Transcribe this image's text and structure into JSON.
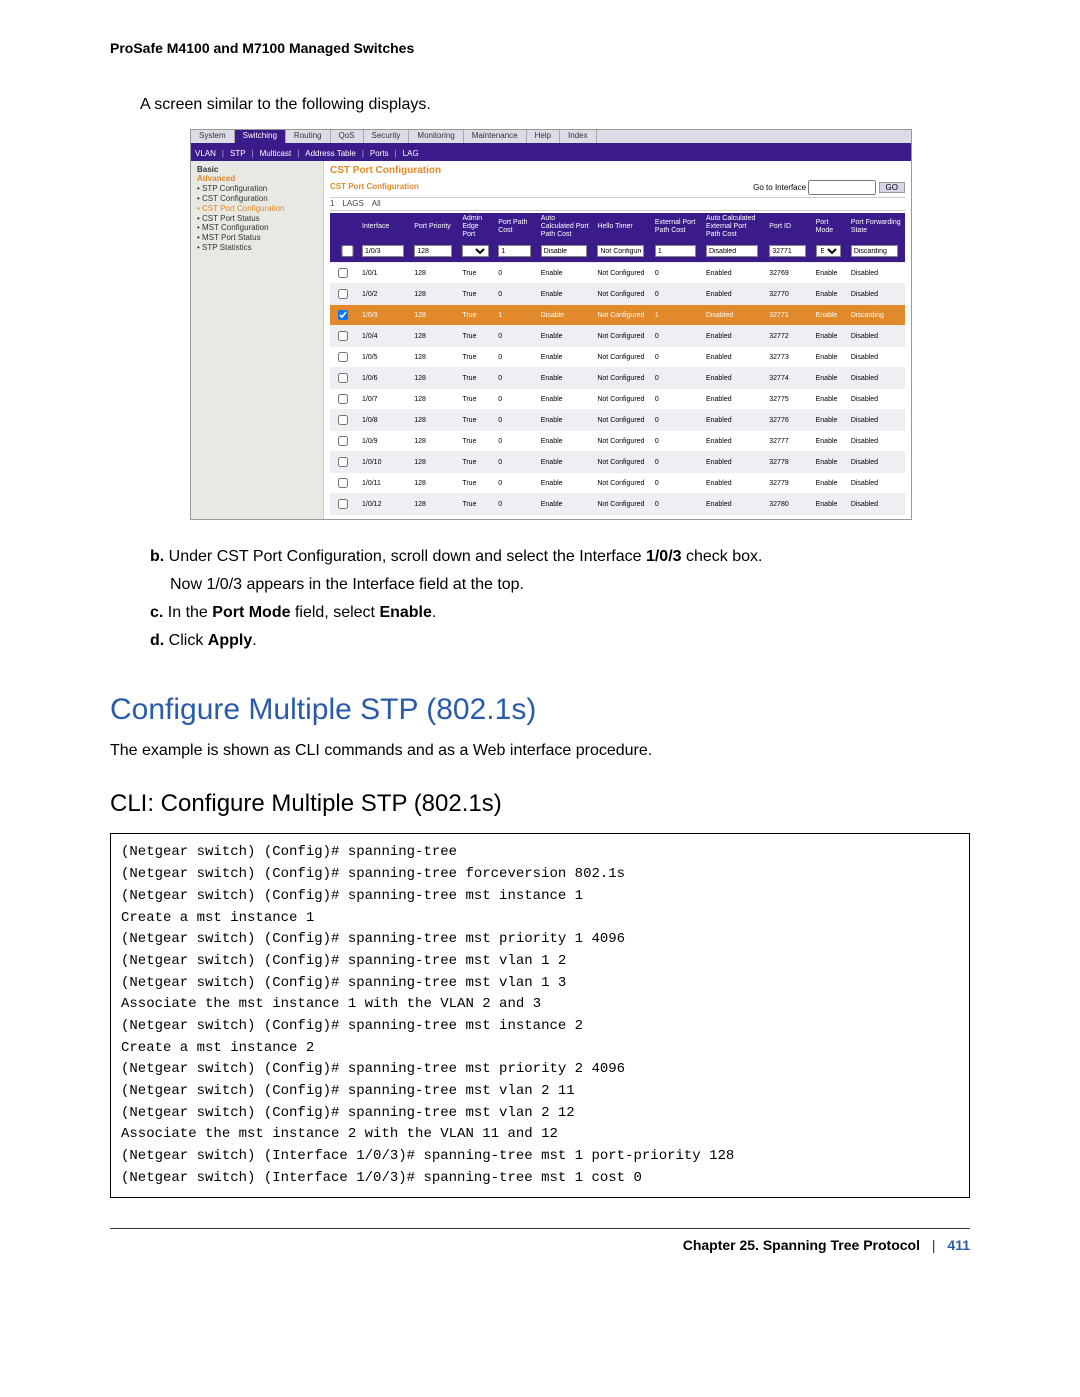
{
  "doc_header": "ProSafe M4100 and M7100 Managed Switches",
  "intro": "A screen similar to the following displays.",
  "nav": {
    "tabs1": [
      "System",
      "Switching",
      "Routing",
      "QoS",
      "Security",
      "Monitoring",
      "Maintenance",
      "Help",
      "Index"
    ],
    "tabs1_active": 1,
    "tabs2": [
      "VLAN",
      "STP",
      "Multicast",
      "Address Table",
      "Ports",
      "LAG"
    ]
  },
  "sidebar": {
    "basic": "Basic",
    "adv": "Advanced",
    "items": [
      "STP Configuration",
      "CST Configuration",
      "CST Port Configuration",
      "CST Port Status",
      "MST Configuration",
      "MST Port Status",
      "STP Statistics"
    ],
    "selected": 2
  },
  "panel": {
    "title": "CST Port Configuration",
    "subtitle": "CST Port Configuration",
    "filters": [
      "1",
      "LAGS",
      "All"
    ],
    "goto_label": "Go to Interface",
    "go_btn": "GO"
  },
  "grid": {
    "columns": [
      "",
      "Interface",
      "Port Priority",
      "Admin Edge Port",
      "Port Path Cost",
      "Auto Calculated Port Path Cost",
      "Hello Timer",
      "External Port Path Cost",
      "Auto Calculated External Port Path Cost",
      "Port ID",
      "Port Mode",
      "Port Forwarding State"
    ],
    "input_row": {
      "interface": "1/0/3",
      "priority": "128",
      "edge": "",
      "cost": "1",
      "auto": "Disable",
      "hello": "Not Configured",
      "ext": "1",
      "autoext": "Disabled",
      "portid": "32771",
      "mode": "Enable",
      "fwd": "Discarding"
    },
    "rows": [
      {
        "sel": false,
        "hl": false,
        "c": [
          "1/0/1",
          "128",
          "True",
          "0",
          "Enable",
          "Not Configured",
          "0",
          "Enabled",
          "32769",
          "Enable",
          "Disabled"
        ]
      },
      {
        "sel": false,
        "hl": false,
        "c": [
          "1/0/2",
          "128",
          "True",
          "0",
          "Enable",
          "Not Configured",
          "0",
          "Enabled",
          "32770",
          "Enable",
          "Disabled"
        ]
      },
      {
        "sel": true,
        "hl": true,
        "c": [
          "1/0/3",
          "128",
          "True",
          "1",
          "Disable",
          "Not Configured",
          "1",
          "Disabled",
          "32771",
          "Enable",
          "Discarding"
        ]
      },
      {
        "sel": false,
        "hl": false,
        "c": [
          "1/0/4",
          "128",
          "True",
          "0",
          "Enable",
          "Not Configured",
          "0",
          "Enabled",
          "32772",
          "Enable",
          "Disabled"
        ]
      },
      {
        "sel": false,
        "hl": false,
        "c": [
          "1/0/5",
          "128",
          "True",
          "0",
          "Enable",
          "Not Configured",
          "0",
          "Enabled",
          "32773",
          "Enable",
          "Disabled"
        ]
      },
      {
        "sel": false,
        "hl": false,
        "c": [
          "1/0/6",
          "128",
          "True",
          "0",
          "Enable",
          "Not Configured",
          "0",
          "Enabled",
          "32774",
          "Enable",
          "Disabled"
        ]
      },
      {
        "sel": false,
        "hl": false,
        "c": [
          "1/0/7",
          "128",
          "True",
          "0",
          "Enable",
          "Not Configured",
          "0",
          "Enabled",
          "32775",
          "Enable",
          "Disabled"
        ]
      },
      {
        "sel": false,
        "hl": false,
        "c": [
          "1/0/8",
          "128",
          "True",
          "0",
          "Enable",
          "Not Configured",
          "0",
          "Enabled",
          "32776",
          "Enable",
          "Disabled"
        ]
      },
      {
        "sel": false,
        "hl": false,
        "c": [
          "1/0/9",
          "128",
          "True",
          "0",
          "Enable",
          "Not Configured",
          "0",
          "Enabled",
          "32777",
          "Enable",
          "Disabled"
        ]
      },
      {
        "sel": false,
        "hl": false,
        "c": [
          "1/0/10",
          "128",
          "True",
          "0",
          "Enable",
          "Not Configured",
          "0",
          "Enabled",
          "32778",
          "Enable",
          "Disabled"
        ]
      },
      {
        "sel": false,
        "hl": false,
        "c": [
          "1/0/11",
          "128",
          "True",
          "0",
          "Enable",
          "Not Configured",
          "0",
          "Enabled",
          "32779",
          "Enable",
          "Disabled"
        ]
      },
      {
        "sel": false,
        "hl": false,
        "c": [
          "1/0/12",
          "128",
          "True",
          "0",
          "Enable",
          "Not Configured",
          "0",
          "Enabled",
          "32780",
          "Enable",
          "Disabled"
        ]
      }
    ]
  },
  "instructions": {
    "b": {
      "letter": "b.",
      "line1_a": "Under CST Port Configuration, scroll down and select the Interface ",
      "line1_b": "1/0/3",
      "line1_c": " check box.",
      "line2": "Now 1/0/3 appears in the Interface field at the top."
    },
    "c": {
      "letter": "c.",
      "text_a": "In the ",
      "text_b": "Port Mode",
      "text_c": " field, select ",
      "text_d": "Enable",
      "text_e": "."
    },
    "d": {
      "letter": "d.",
      "text_a": "Click ",
      "text_b": "Apply",
      "text_c": "."
    }
  },
  "section_heading": "Configure Multiple STP (802.1s)",
  "section_intro": "The example is shown as CLI commands and as a Web interface procedure.",
  "subsection_heading": "CLI: Configure Multiple STP (802.1s)",
  "cli": "(Netgear switch) (Config)# spanning-tree\n(Netgear switch) (Config)# spanning-tree forceversion 802.1s\n(Netgear switch) (Config)# spanning-tree mst instance 1\nCreate a mst instance 1\n(Netgear switch) (Config)# spanning-tree mst priority 1 4096\n(Netgear switch) (Config)# spanning-tree mst vlan 1 2\n(Netgear switch) (Config)# spanning-tree mst vlan 1 3\nAssociate the mst instance 1 with the VLAN 2 and 3\n(Netgear switch) (Config)# spanning-tree mst instance 2\nCreate a mst instance 2\n(Netgear switch) (Config)# spanning-tree mst priority 2 4096\n(Netgear switch) (Config)# spanning-tree mst vlan 2 11\n(Netgear switch) (Config)# spanning-tree mst vlan 2 12\nAssociate the mst instance 2 with the VLAN 11 and 12\n(Netgear switch) (Interface 1/0/3)# spanning-tree mst 1 port-priority 128\n(Netgear switch) (Interface 1/0/3)# spanning-tree mst 1 cost 0",
  "footer": {
    "chapter": "Chapter 25.  Spanning Tree Protocol",
    "page": "411"
  }
}
